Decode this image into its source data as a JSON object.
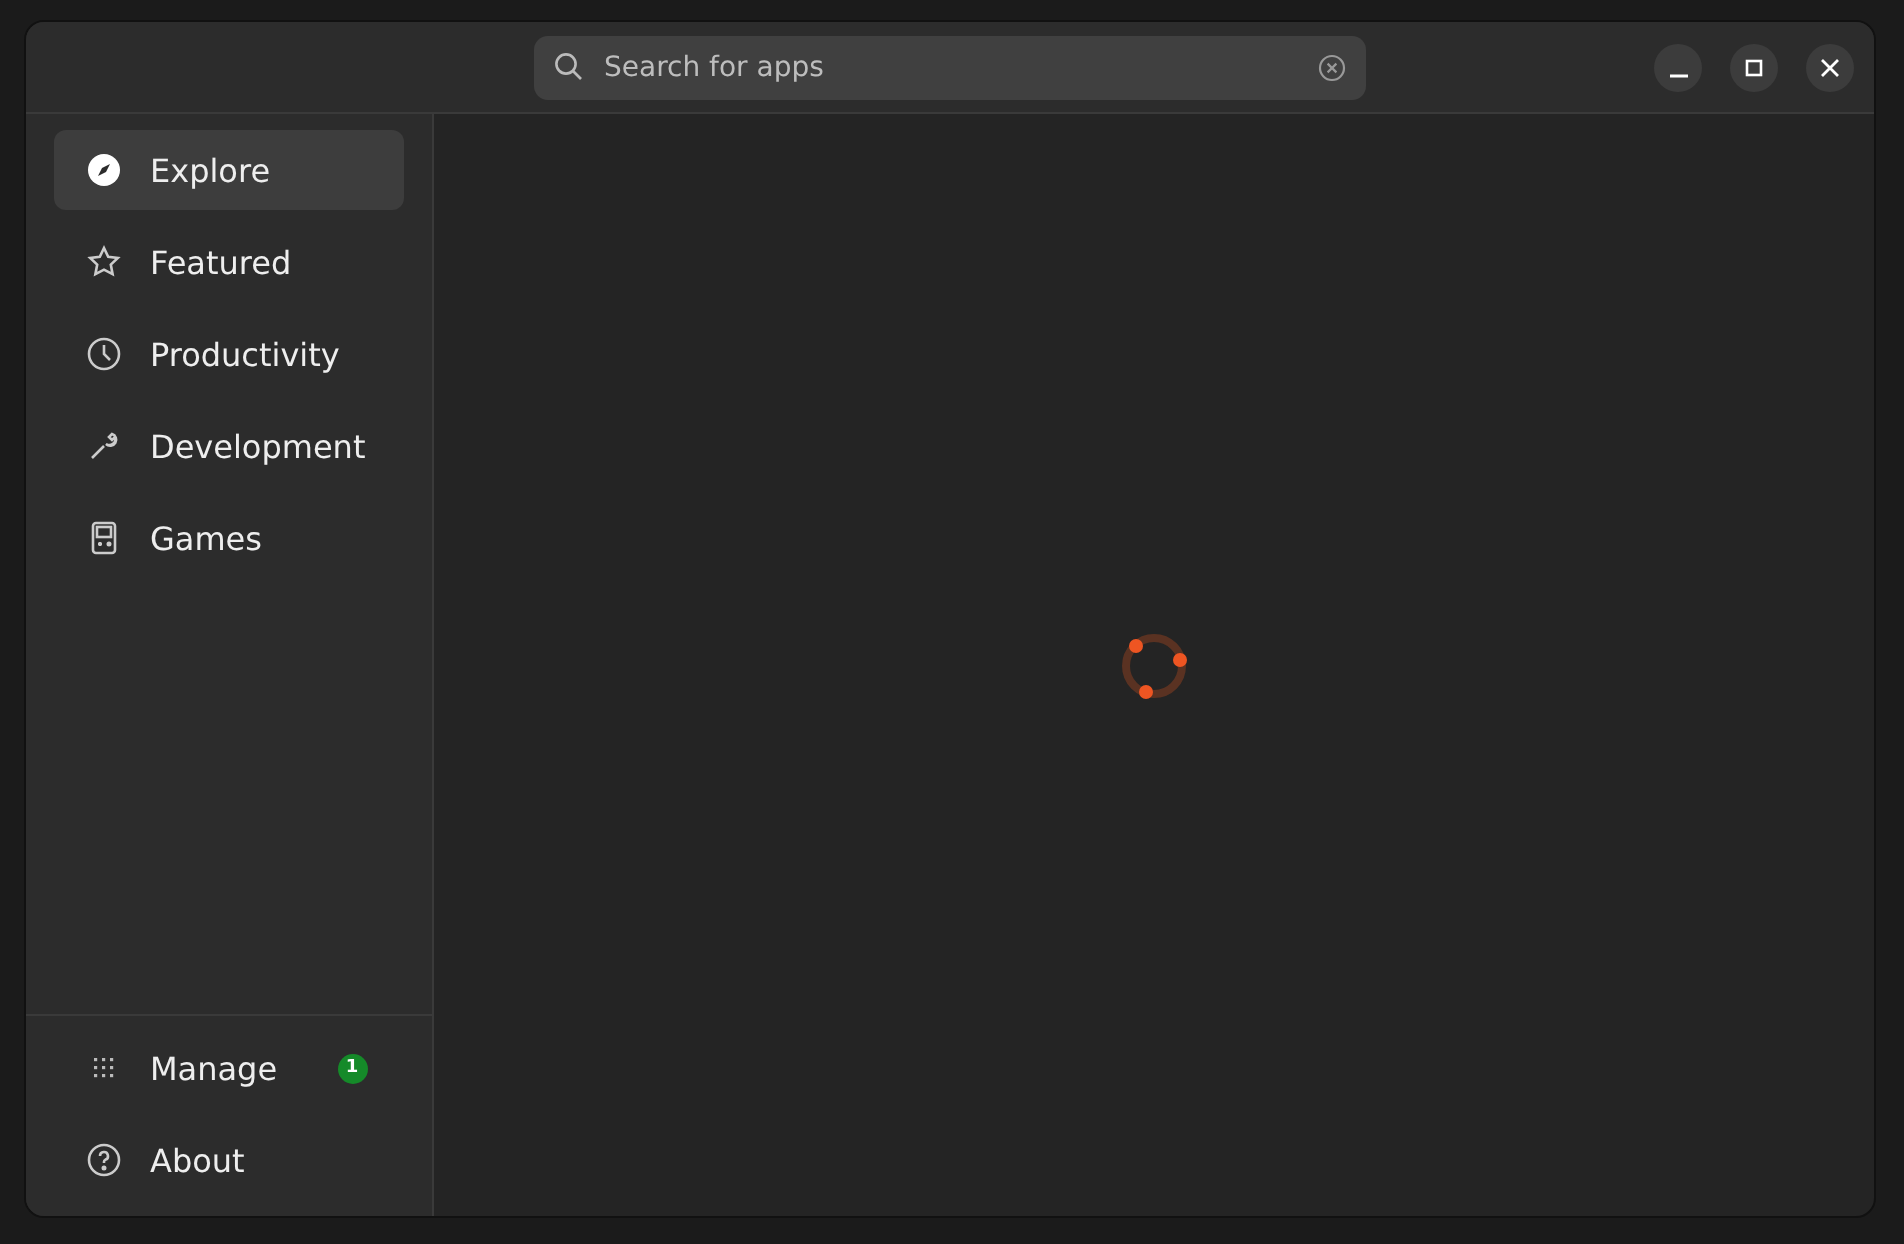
{
  "search": {
    "placeholder": "Search for apps"
  },
  "sidebar": {
    "items": [
      {
        "label": "Explore",
        "selected": true
      },
      {
        "label": "Featured",
        "selected": false
      },
      {
        "label": "Productivity",
        "selected": false
      },
      {
        "label": "Development",
        "selected": false
      },
      {
        "label": "Games",
        "selected": false
      }
    ],
    "footer_items": [
      {
        "label": "Manage",
        "selected": false,
        "badge": "1"
      },
      {
        "label": "About",
        "selected": false
      }
    ]
  },
  "content": {
    "loading": true
  }
}
